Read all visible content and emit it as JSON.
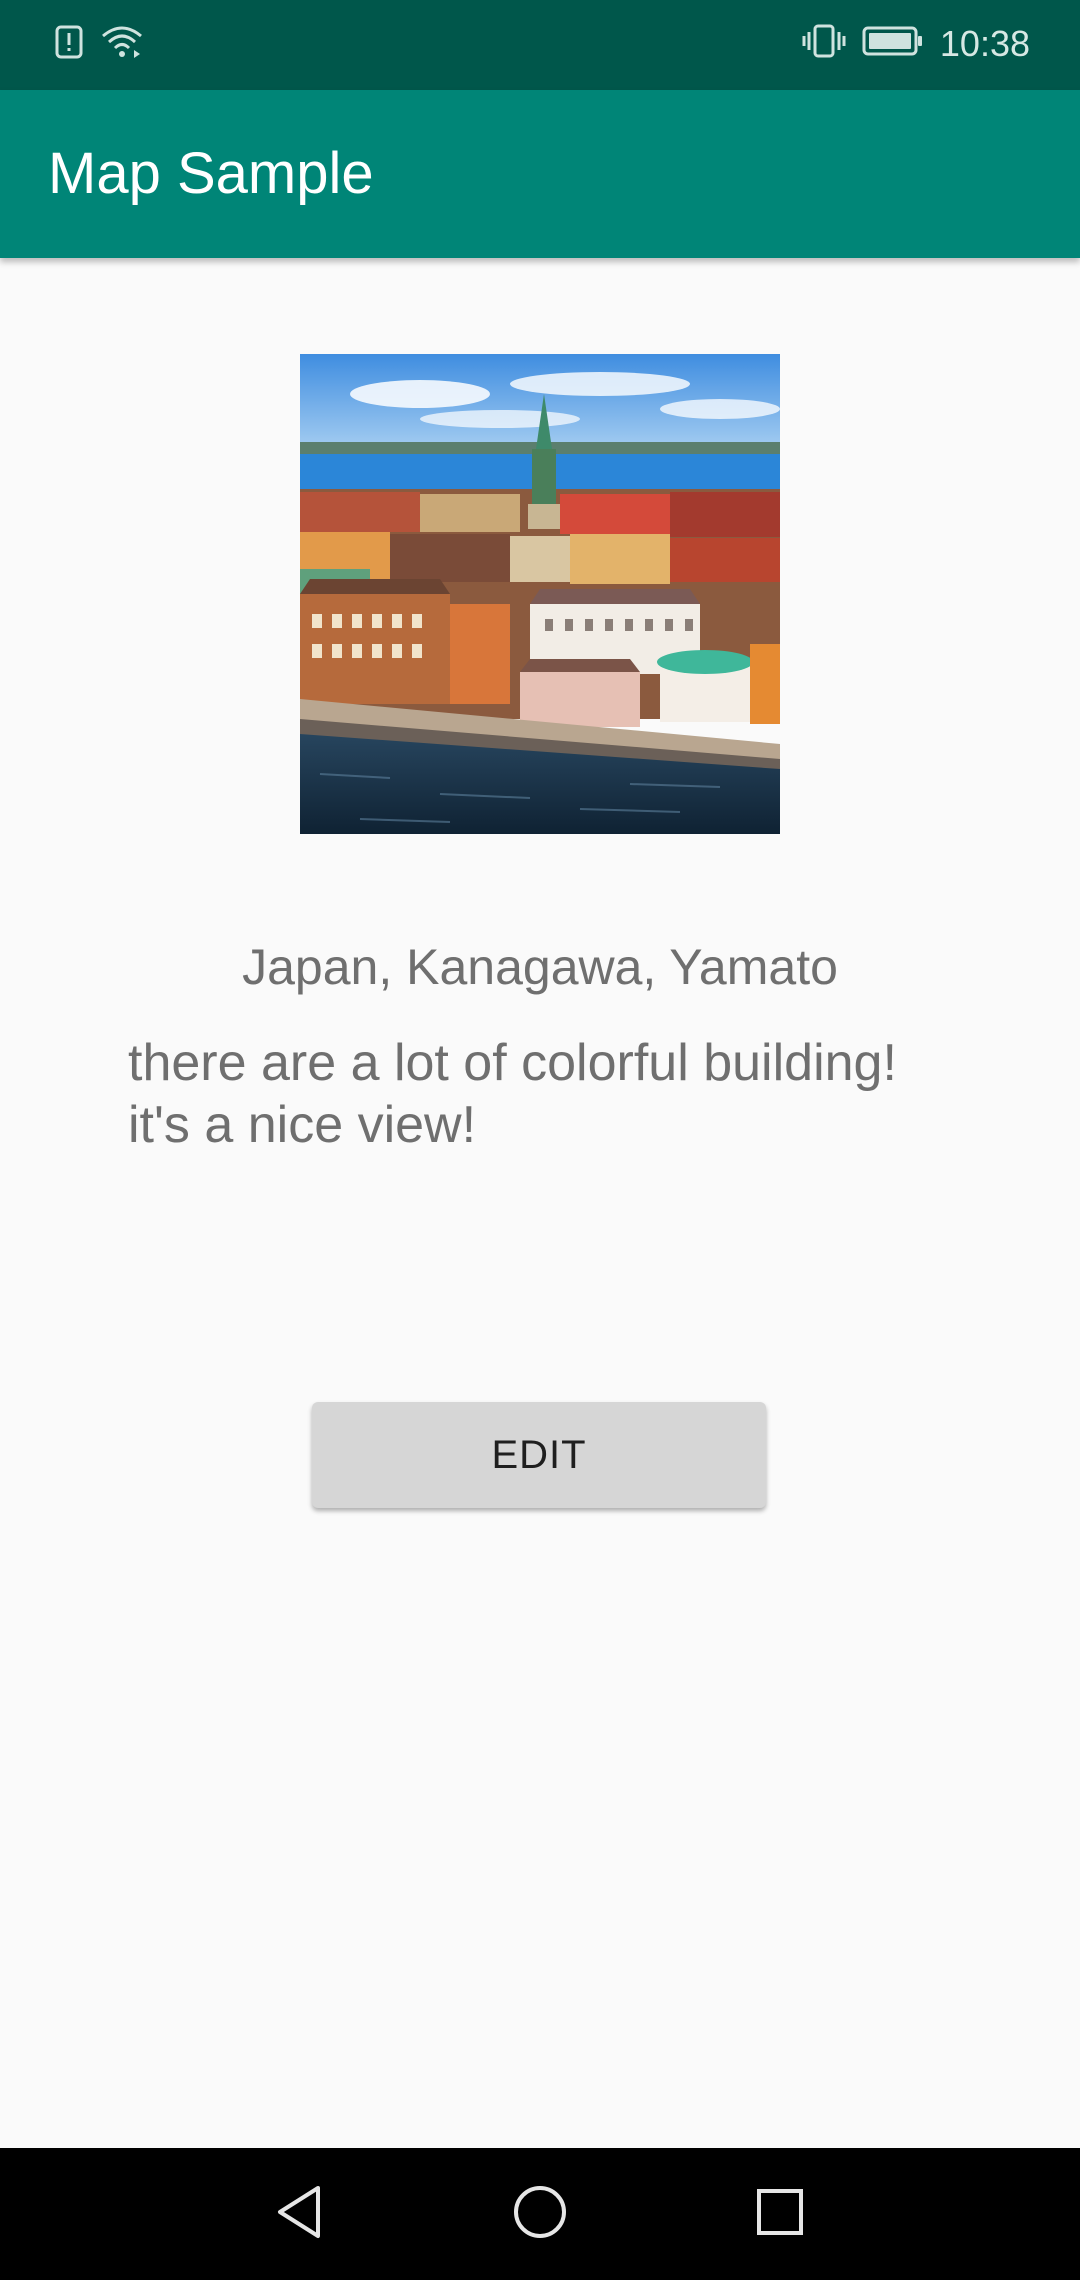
{
  "status_bar": {
    "time": "10:38",
    "icons": [
      "alert-icon",
      "wifi-icon",
      "vibrate-icon",
      "battery-icon"
    ]
  },
  "app_bar": {
    "title": "Map Sample"
  },
  "content": {
    "photo_description_icon": "city-photo",
    "location": "Japan, Kanagawa, Yamato",
    "description": "there are a lot of colorful building!\nit's a nice view!",
    "edit_label": "EDIT"
  },
  "nav_bar": {
    "buttons": [
      "back-icon",
      "home-icon",
      "recents-icon"
    ]
  },
  "colors": {
    "status_bar": "#00574b",
    "app_bar": "#008577",
    "background": "#fafafa",
    "button": "#d6d6d6",
    "text_gray": "#6f6f6f"
  }
}
